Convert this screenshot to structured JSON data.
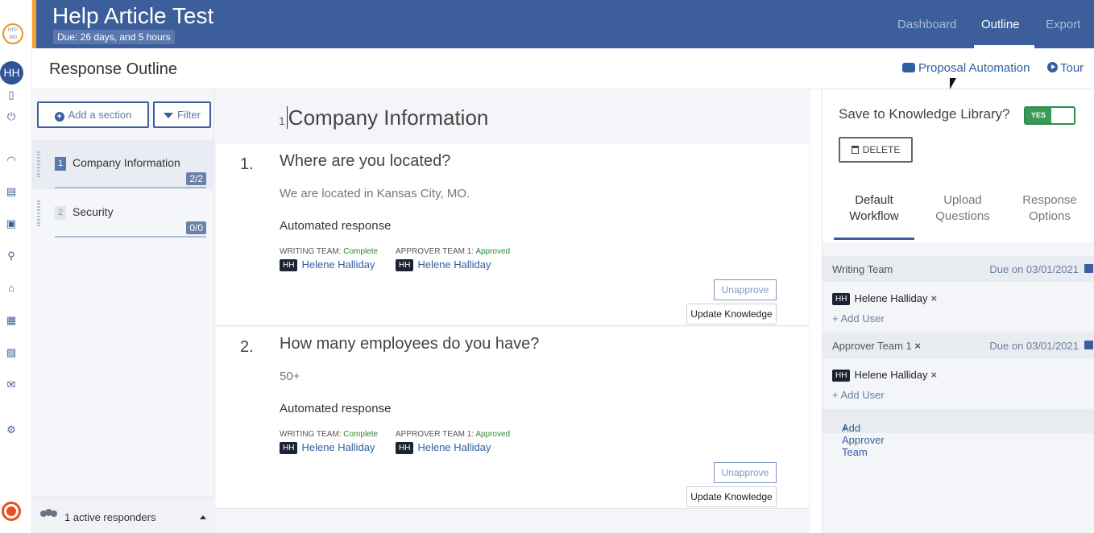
{
  "rail": {
    "logo_text": "RFP 360",
    "avatar": "HH"
  },
  "header": {
    "title": "Help Article Test",
    "due": "Due: 26 days, and 5 hours",
    "nav": [
      "Dashboard",
      "Outline",
      "Export"
    ],
    "active_nav": "Outline"
  },
  "subheader": {
    "page_title": "Response Outline",
    "proposal_automation": "Proposal Automation",
    "tour": "Tour"
  },
  "sections_panel": {
    "add_section": "Add a section",
    "filter": "Filter",
    "items": [
      {
        "num": "1",
        "label": "Company Information",
        "count": "2/2",
        "active": true
      },
      {
        "num": "2",
        "label": "Security",
        "count": "0/0",
        "active": false
      }
    ],
    "footer": "1 active responders"
  },
  "center": {
    "section_number": "1",
    "section_title": "Company Information",
    "questions": [
      {
        "num": "1.",
        "text": "Where are you located?",
        "answer": "We are located in Kansas City, MO.",
        "auto": "Automated response",
        "writing_label": "WRITING TEAM:",
        "writing_status": "Complete",
        "writing_user_initials": "HH",
        "writing_user": "Helene Halliday",
        "approver_label": "APPROVER TEAM 1:",
        "approver_status": "Approved",
        "approver_user_initials": "HH",
        "approver_user": "Helene Halliday",
        "unapprove": "Unapprove",
        "update": "Update Knowledge"
      },
      {
        "num": "2.",
        "text": "How many employees do you have?",
        "answer": "50+",
        "auto": "Automated response",
        "writing_label": "WRITING TEAM:",
        "writing_status": "Complete",
        "writing_user_initials": "HH",
        "writing_user": "Helene Halliday",
        "approver_label": "APPROVER TEAM 1:",
        "approver_status": "Approved",
        "approver_user_initials": "HH",
        "approver_user": "Helene Halliday",
        "unapprove": "Unapprove",
        "update": "Update Knowledge"
      }
    ]
  },
  "right_panel": {
    "save_label": "Save to Knowledge Library?",
    "toggle_value": "YES",
    "delete": "DELETE",
    "tabs": [
      {
        "line1": "Default",
        "line2": "Workflow"
      },
      {
        "line1": "Upload",
        "line2": "Questions"
      },
      {
        "line1": "Response",
        "line2": "Options"
      }
    ],
    "active_tab": "Default Workflow",
    "writing_team": {
      "name": "Writing Team",
      "due": "Due on 03/01/2021",
      "user_initials": "HH",
      "user": "Helene Halliday",
      "add_user": "Add User"
    },
    "approver_team": {
      "name": "Approver Team 1",
      "due": "Due on 03/01/2021",
      "user_initials": "HH",
      "user": "Helene Halliday",
      "add_user": "Add User"
    },
    "add_approver_team": "Add Approver Team"
  },
  "colors": {
    "header_bg": "#3c5e9b",
    "accent_orange": "#f0a330",
    "link_blue": "#2f5f9e",
    "status_green": "#2c8a2c"
  }
}
